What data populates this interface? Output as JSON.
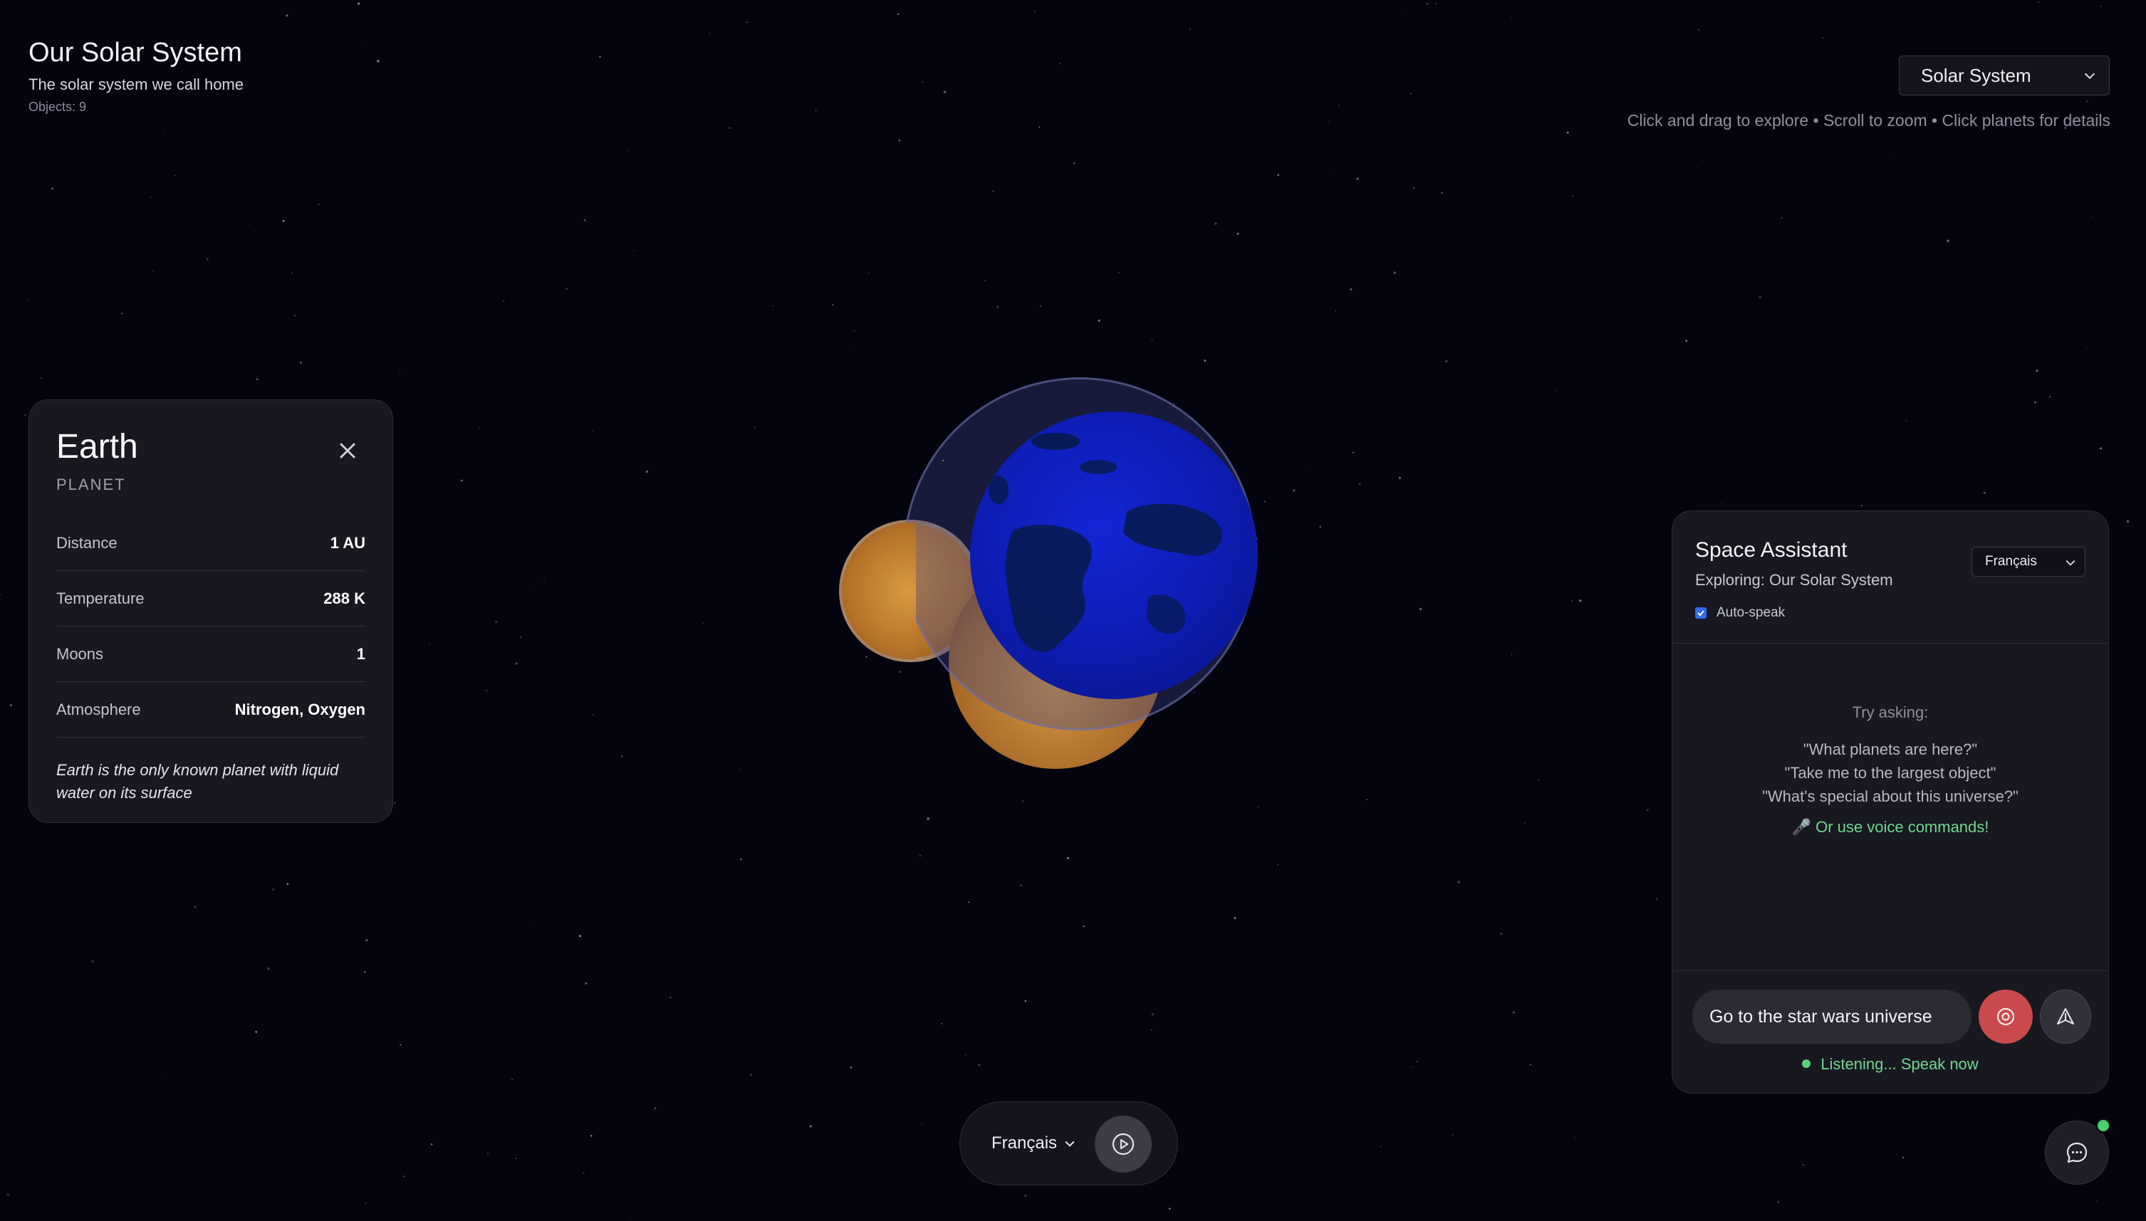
{
  "header": {
    "title": "Our Solar System",
    "subtitle": "The solar system we call home",
    "objects": "Objects: 9"
  },
  "universe_select": {
    "value": "Solar System",
    "icon": "chevron-down-icon"
  },
  "hint": "Click and drag to explore • Scroll to zoom • Click planets for details",
  "info_card": {
    "name": "Earth",
    "type": "PLANET",
    "close_icon": "close-icon",
    "rows": [
      {
        "label": "Distance",
        "value": "1 AU"
      },
      {
        "label": "Temperature",
        "value": "288 K"
      },
      {
        "label": "Moons",
        "value": "1"
      },
      {
        "label": "Atmosphere",
        "value": "Nitrogen, Oxygen"
      }
    ],
    "fact": "Earth is the only known planet with liquid water on its surface"
  },
  "assistant": {
    "title": "Space Assistant",
    "subtitle": "Exploring: Our Solar System",
    "language": "Français",
    "auto_speak_label": "Auto-speak",
    "auto_speak_checked": true,
    "try_title": "Try asking:",
    "suggestions": [
      "\"What planets are here?\"",
      "\"Take me to the largest object\"",
      "\"What's special about this universe?\""
    ],
    "voice_hint": "🎤 Or use voice commands!",
    "input_value": "Go to the star wars universe",
    "mic_icon": "record-icon",
    "send_icon": "send-icon",
    "status": "Listening... Speak now"
  },
  "bottom_bar": {
    "language": "Français",
    "play_icon": "play-icon"
  },
  "chat_fab": {
    "icon": "chat-icon"
  },
  "colors": {
    "background": "#04040f",
    "panel": "#171820",
    "accent_green": "#6fd88e",
    "mic_red": "#c94a4c",
    "earth_blue": "#0f1fc0",
    "venus_orange": "#d99a3c"
  }
}
